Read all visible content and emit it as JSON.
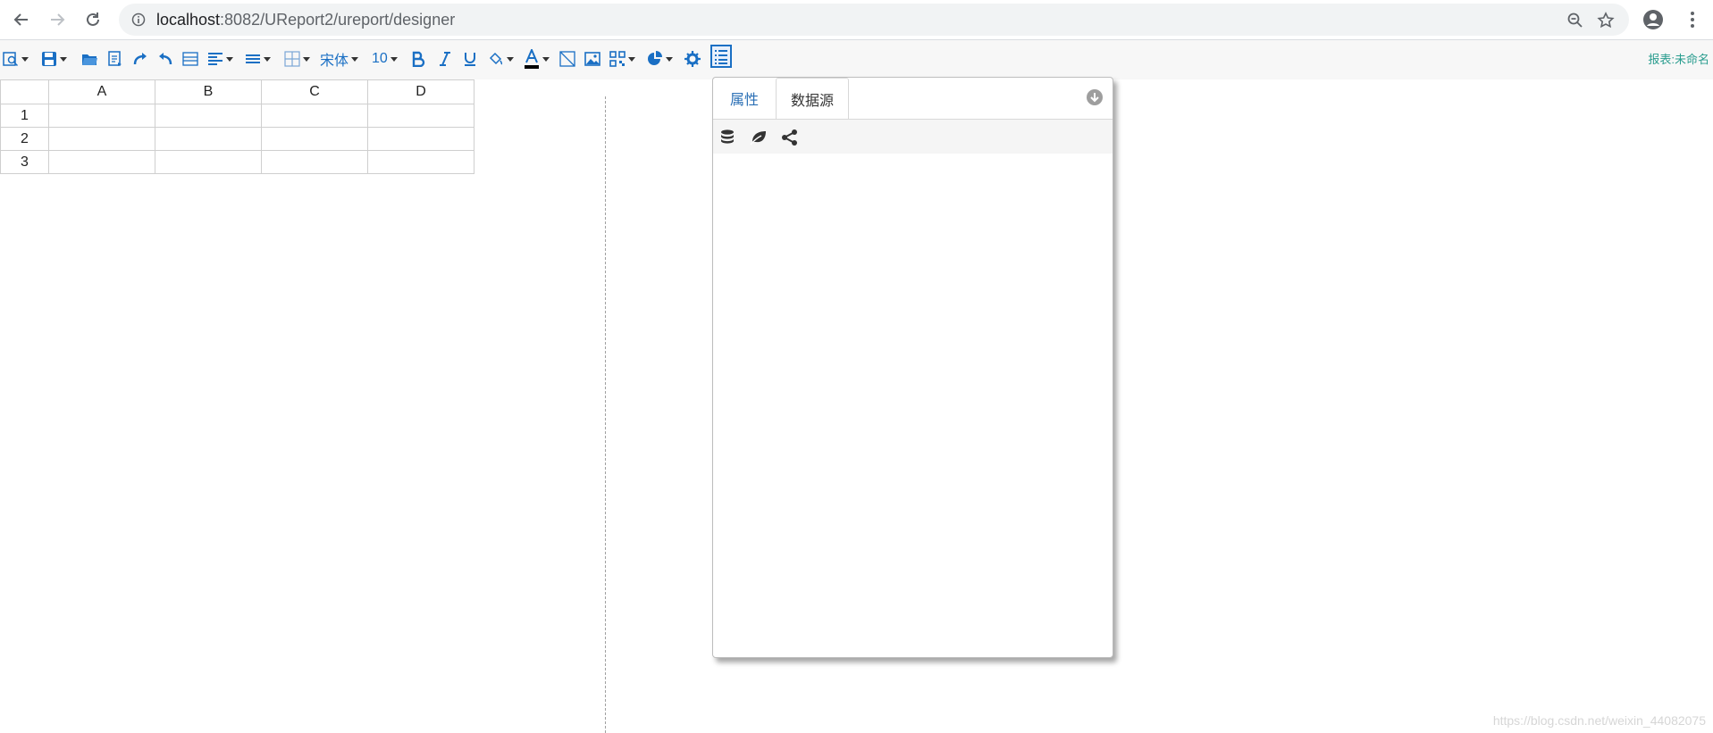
{
  "browser": {
    "url_host": "localhost",
    "url_rest": ":8082/UReport2/ureport/designer"
  },
  "toolbar": {
    "font_name": "宋体",
    "font_size": "10",
    "report_name": "报表:未命名",
    "colors": {
      "accent": "#1a6fc4",
      "report_name": "#2a9d8f"
    }
  },
  "grid": {
    "columns": [
      "A",
      "B",
      "C",
      "D"
    ],
    "rows": [
      "1",
      "2",
      "3"
    ]
  },
  "panel": {
    "tabs": [
      {
        "label": "属性"
      },
      {
        "label": "数据源"
      }
    ],
    "ds_icons": [
      "database-icon",
      "leaf-icon",
      "share-icon"
    ]
  },
  "watermark": "https://blog.csdn.net/weixin_44082075"
}
